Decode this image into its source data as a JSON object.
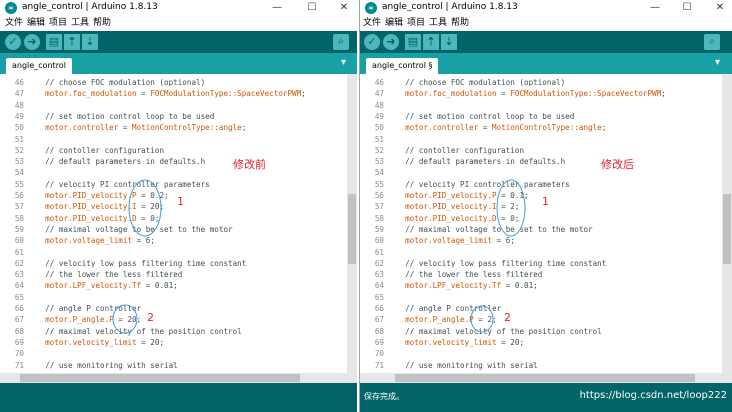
{
  "left": {
    "title": "angle_control | Arduino 1.8.13",
    "menu": [
      "文件",
      "编辑",
      "项目",
      "工具",
      "帮助"
    ],
    "tab": "angle_control",
    "annotation": "修改前",
    "marks": [
      "1",
      "2"
    ],
    "status": ""
  },
  "right": {
    "title": "angle_control | Arduino 1.8.13",
    "menu": [
      "文件",
      "编辑",
      "项目",
      "工具",
      "帮助"
    ],
    "tab": "angle_control §",
    "annotation": "修改后",
    "marks": [
      "1",
      "2"
    ],
    "status": "保存完成。",
    "watermark": "https://blog.csdn.net/loop222"
  },
  "window_controls": [
    "—",
    "☐",
    "✕"
  ],
  "code_left": [
    {
      "n": "46",
      "t": "  // choose FOC modulation (optional)"
    },
    {
      "n": "47",
      "t": "  motor.foc_modulation = FOCModulationType::SpaceVectorPWM;"
    },
    {
      "n": "48",
      "t": ""
    },
    {
      "n": "49",
      "t": "  // set motion control loop to be used"
    },
    {
      "n": "50",
      "t": "  motor.controller = MotionControlType::angle;"
    },
    {
      "n": "51",
      "t": ""
    },
    {
      "n": "52",
      "t": "  // contoller configuration"
    },
    {
      "n": "53",
      "t": "  // default parameters in defaults.h"
    },
    {
      "n": "54",
      "t": ""
    },
    {
      "n": "55",
      "t": "  // velocity PI controller parameters"
    },
    {
      "n": "56",
      "t": "  motor.PID_velocity.P = 0.2;"
    },
    {
      "n": "57",
      "t": "  motor.PID_velocity.I = 20;"
    },
    {
      "n": "58",
      "t": "  motor.PID_velocity.D = 0;"
    },
    {
      "n": "59",
      "t": "  // maximal voltage to be set to the motor"
    },
    {
      "n": "60",
      "t": "  motor.voltage_limit = 6;"
    },
    {
      "n": "61",
      "t": ""
    },
    {
      "n": "62",
      "t": "  // velocity low pass filtering time constant"
    },
    {
      "n": "63",
      "t": "  // the lower the less filtered"
    },
    {
      "n": "64",
      "t": "  motor.LPF_velocity.Tf = 0.01;"
    },
    {
      "n": "65",
      "t": ""
    },
    {
      "n": "66",
      "t": "  // angle P controller"
    },
    {
      "n": "67",
      "t": "  motor.P_angle.P = 20;"
    },
    {
      "n": "68",
      "t": "  // maximal velocity of the position control"
    },
    {
      "n": "69",
      "t": "  motor.velocity_limit = 20;"
    },
    {
      "n": "70",
      "t": ""
    },
    {
      "n": "71",
      "t": "  // use monitoring with serial"
    }
  ],
  "code_right": [
    {
      "n": "46",
      "t": "  // choose FOC modulation (optional)"
    },
    {
      "n": "47",
      "t": "  motor.foc_modulation = FOCModulationType::SpaceVectorPWM;"
    },
    {
      "n": "48",
      "t": ""
    },
    {
      "n": "49",
      "t": "  // set motion control loop to be used"
    },
    {
      "n": "50",
      "t": "  motor.controller = MotionControlType::angle;"
    },
    {
      "n": "51",
      "t": ""
    },
    {
      "n": "52",
      "t": "  // contoller configuration"
    },
    {
      "n": "53",
      "t": "  // default parameters in defaults.h"
    },
    {
      "n": "54",
      "t": ""
    },
    {
      "n": "55",
      "t": "  // velocity PI controller parameters"
    },
    {
      "n": "56",
      "t": "  motor.PID_velocity.P = 0.1;"
    },
    {
      "n": "57",
      "t": "  motor.PID_velocity.I = 2;"
    },
    {
      "n": "58",
      "t": "  motor.PID_velocity.D = 0;"
    },
    {
      "n": "59",
      "t": "  // maximal voltage to be set to the motor"
    },
    {
      "n": "60",
      "t": "  motor.voltage_limit = 6;"
    },
    {
      "n": "61",
      "t": ""
    },
    {
      "n": "62",
      "t": "  // velocity low pass filtering time constant"
    },
    {
      "n": "63",
      "t": "  // the lower the less filtered"
    },
    {
      "n": "64",
      "t": "  motor.LPF_velocity.Tf = 0.01;"
    },
    {
      "n": "65",
      "t": ""
    },
    {
      "n": "66",
      "t": "  // angle P controller"
    },
    {
      "n": "67",
      "t": "  motor.P_angle.P = 2;"
    },
    {
      "n": "68",
      "t": "  // maximal velocity of the position control"
    },
    {
      "n": "69",
      "t": "  motor.velocity_limit = 20;"
    },
    {
      "n": "70",
      "t": ""
    },
    {
      "n": "71",
      "t": "  // use monitoring with serial"
    }
  ],
  "colors": {
    "toolbar": "#006468",
    "tabbar": "#17a1a5",
    "keyword": "#d35400",
    "annotation": "#e0242b",
    "circle": "#3aa0d8"
  }
}
